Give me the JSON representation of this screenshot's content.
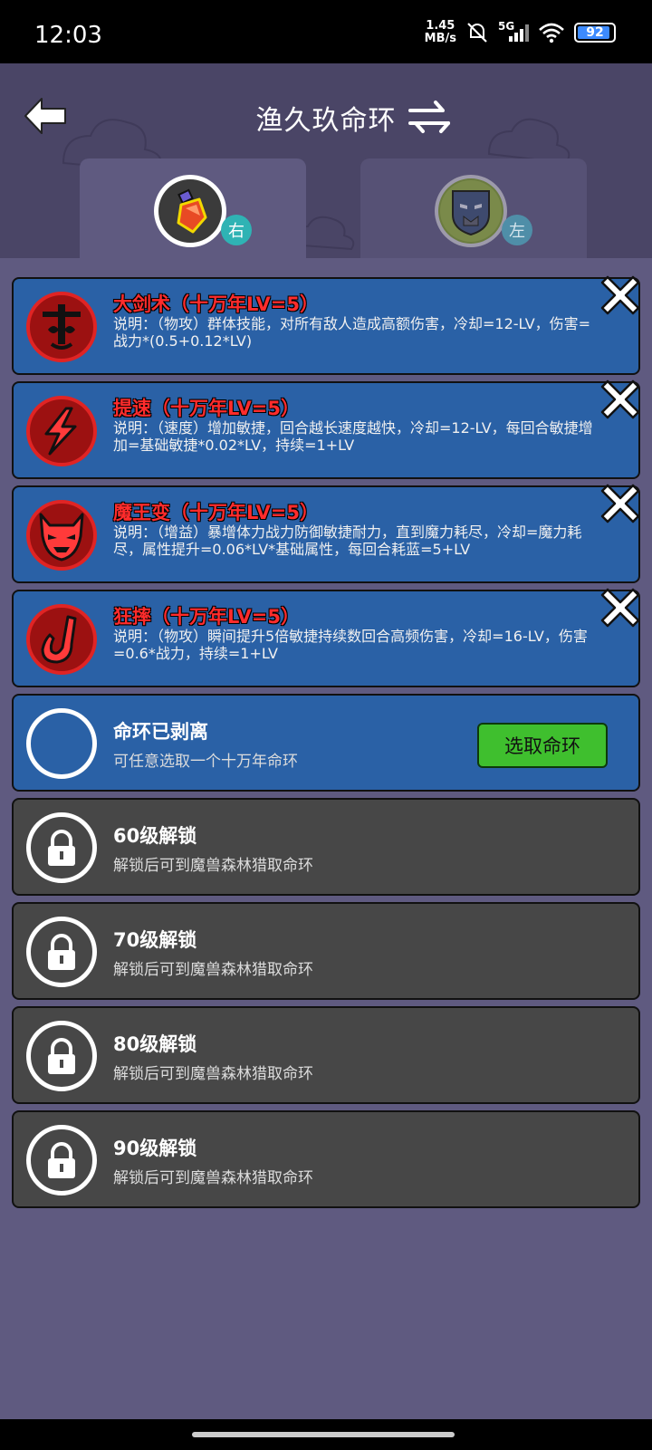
{
  "status_bar": {
    "time": "12:03",
    "net_speed_value": "1.45",
    "net_speed_unit": "MB/s",
    "network": "5G",
    "battery": "92",
    "battery_level": 0.92
  },
  "header": {
    "title": "渔久玖命环"
  },
  "tabs": [
    {
      "badge": "右",
      "state": "active"
    },
    {
      "badge": "左",
      "state": "inactive"
    }
  ],
  "skills": [
    {
      "name": "大剑术（十万年LV=5）",
      "desc": "说明：（物攻）群体技能，对所有敌人造成高额伤害，冷却=12-LV，伤害=战力*(0.5+0.12*LV)",
      "icon": "sword-icon"
    },
    {
      "name": "提速（十万年LV=5）",
      "desc": "说明：（速度）增加敏捷，回合越长速度越快，冷却=12-LV，每回合敏捷增加=基础敏捷*0.02*LV，持续=1+LV",
      "icon": "lightning-icon"
    },
    {
      "name": "魔王变（十万年LV=5）",
      "desc": "说明：（增益）暴增体力战力防御敏捷耐力，直到魔力耗尽，冷却=魔力耗尽，属性提升=0.06*LV*基础属性，每回合耗蓝=5+LV",
      "icon": "demon-mask-icon"
    },
    {
      "name": "狂摔（十万年LV=5）",
      "desc": "说明：（物攻）瞬间提升5倍敏捷持续数回合高频伤害，冷却=16-LV，伤害=0.6*战力，持续=1+LV",
      "icon": "slam-icon"
    }
  ],
  "empty_slot": {
    "title": "命环已剥离",
    "subtitle": "可任意选取一个十万年命环",
    "button": "选取命环"
  },
  "locked_slots": [
    {
      "title": "60级解锁",
      "subtitle": "解锁后可到魔兽森林猎取命环"
    },
    {
      "title": "70级解锁",
      "subtitle": "解锁后可到魔兽森林猎取命环"
    },
    {
      "title": "80级解锁",
      "subtitle": "解锁后可到魔兽森林猎取命环"
    },
    {
      "title": "90级解锁",
      "subtitle": "解锁后可到魔兽森林猎取命环"
    }
  ],
  "colors": {
    "background": "#5f5a80",
    "skill_card": "#2a61a6",
    "locked_card": "#474747",
    "skill_name": "#ff2c2c",
    "select_button": "#3fbf2e"
  }
}
